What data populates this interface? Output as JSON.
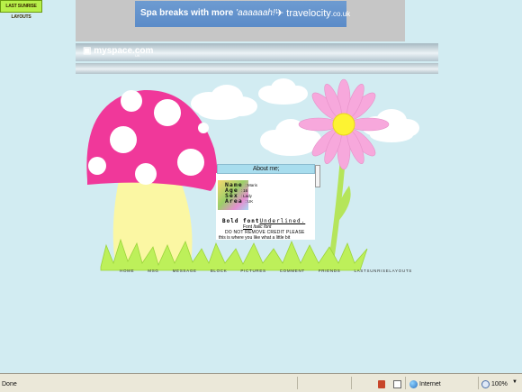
{
  "badge": {
    "text": "LAST SUNRISE LAYOUTS"
  },
  "ad": {
    "headline": "Spa breaks with more ",
    "headline_em": "'aaaaaah!'",
    "brand": "travelocity",
    "brand_tld": ".co.uk"
  },
  "myspace": {
    "logo": "myspace.com",
    "sub": "UK"
  },
  "about": {
    "header": "About me;",
    "fields": [
      {
        "label": "Name",
        "value": ": Maris"
      },
      {
        "label": "Age",
        "value": ": 16"
      },
      {
        "label": "Sex",
        "value": ": Lady"
      },
      {
        "label": "Area",
        "value": ": UK"
      }
    ],
    "bold_text": "Bold font",
    "underline_text": "Underlined.",
    "font_text": "Font",
    "italic_text": "Italic font",
    "credit_text": "DO NOT REMOVE CREDIT PLEASE",
    "body_text": "this is where you like what a little bit"
  },
  "nav": [
    "HOME",
    "MSG",
    "MESSAGE",
    "BLOCK",
    "PICTURES",
    "COMMENT",
    "FRIENDS",
    "LASTSUNRISELAYOUTS"
  ],
  "statusbar": {
    "status": "Done",
    "zone": "Internet",
    "zoom": "100%"
  },
  "colors": {
    "page_bg": "#d2ecf2",
    "mushroom_cap": "#f0389a",
    "stem": "#fbf7a3",
    "grass": "#bdf05a",
    "petals": "#f7a8dc",
    "flower_center": "#fdf332"
  }
}
